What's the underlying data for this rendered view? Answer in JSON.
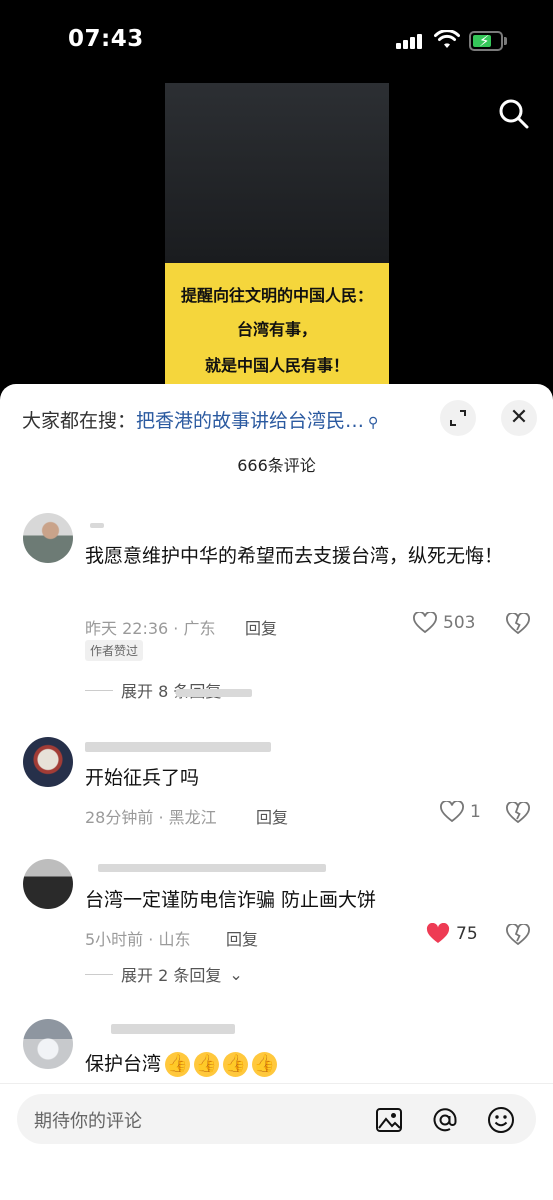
{
  "status_bar": {
    "time": "07:43",
    "battery_color": "#35c759"
  },
  "video": {
    "caption_lines": [
      "提醒向往文明的中国人民：",
      "台湾有事，",
      "就是中国人民有事！"
    ]
  },
  "sheet": {
    "search_prefix": "大家都在搜：",
    "search_query": "把香港的故事讲给台湾民…",
    "comment_count": "666条评论"
  },
  "comments": [
    {
      "text": "我愿意维护中华的希望而去支援台湾，纵死无悔！",
      "time_location": "昨天 22:36 · 广东",
      "reply_label": "回复",
      "likes": "503",
      "liked": false,
      "badge": "作者赞过",
      "expand_label": "展开 8 条回复"
    },
    {
      "text": "开始征兵了吗",
      "time_location": "28分钟前 · 黑龙江",
      "reply_label": "回复",
      "likes": "1",
      "liked": false
    },
    {
      "text": "台湾一定谨防电信诈骗 防止画大饼",
      "time_location": "5小时前 · 山东",
      "reply_label": "回复",
      "likes": "75",
      "liked": true,
      "like_color": "#ee3b54",
      "expand_label": "展开 2 条回复"
    },
    {
      "text": "保护台湾",
      "emoji": [
        "thumbs-up",
        "thumbs-up",
        "thumbs-up",
        "thumbs-up"
      ]
    }
  ],
  "input": {
    "placeholder": "期待你的评论",
    "icons": [
      "image-icon",
      "at-icon",
      "emoji-icon"
    ]
  }
}
